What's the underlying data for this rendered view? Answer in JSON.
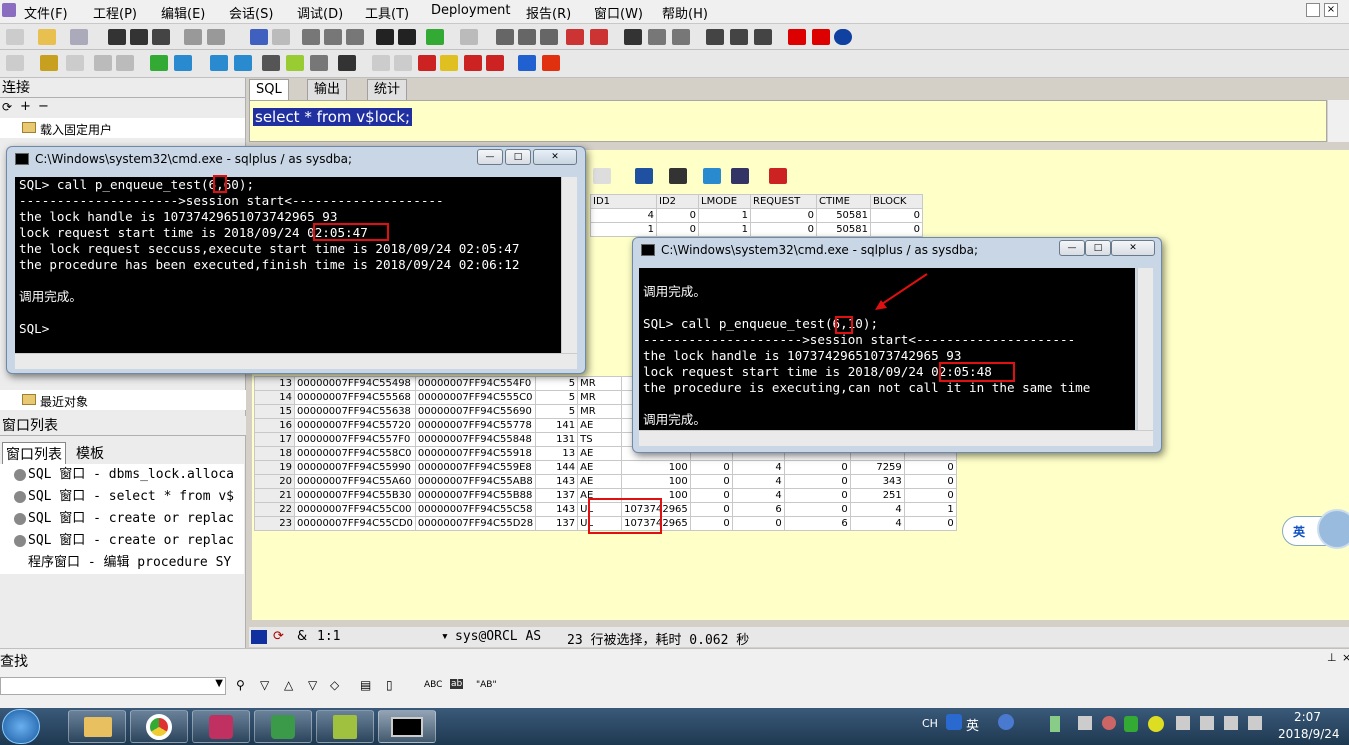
{
  "menu": [
    "文件(F)",
    "工程(P)",
    "编辑(E)",
    "会话(S)",
    "调试(D)",
    "工具(T)",
    "Deployment",
    "报告(R)",
    "窗口(W)",
    "帮助(H)"
  ],
  "left": {
    "connect_title": "连接",
    "tree_item": "载入固定用户",
    "recent_item": "最近对象",
    "winlist_title": "窗口列表",
    "tabs": [
      "窗口列表",
      "模板"
    ],
    "windows": [
      "SQL 窗口 - dbms_lock.alloca",
      "SQL 窗口 - select * from v$",
      "SQL 窗口 - create or replac",
      "SQL 窗口 - create or replac",
      "程序窗口 - 编辑 procedure SY"
    ]
  },
  "sql_tabs": [
    "SQL",
    "输出",
    "统计"
  ],
  "editor_text": "select * from v$lock;",
  "grid": {
    "headers": [
      "ID1",
      "ID2",
      "LMODE",
      "REQUEST",
      "CTIME",
      "BLOCK"
    ],
    "top_rows": [
      [
        "4",
        "0",
        "1",
        "0",
        "50581",
        "0"
      ],
      [
        "1",
        "0",
        "1",
        "0",
        "50581",
        "0"
      ]
    ],
    "rows": [
      [
        "13",
        "00000007FF94C55498",
        "00000007FF94C554F0",
        "5",
        "MR",
        "",
        "",
        "",
        "",
        "",
        ""
      ],
      [
        "14",
        "00000007FF94C55568",
        "00000007FF94C555C0",
        "5",
        "MR",
        "",
        "",
        "",
        "",
        "",
        ""
      ],
      [
        "15",
        "00000007FF94C55638",
        "00000007FF94C55690",
        "5",
        "MR",
        "",
        "",
        "",
        "",
        "",
        ""
      ],
      [
        "16",
        "00000007FF94C55720",
        "00000007FF94C55778",
        "141",
        "AE",
        "",
        "",
        "",
        "",
        "",
        ""
      ],
      [
        "17",
        "00000007FF94C557F0",
        "00000007FF94C55848",
        "131",
        "TS",
        "",
        "",
        "",
        "",
        "",
        ""
      ],
      [
        "18",
        "00000007FF94C558C0",
        "00000007FF94C55918",
        "13",
        "AE",
        "",
        "",
        "",
        "",
        "",
        ""
      ],
      [
        "19",
        "00000007FF94C55990",
        "00000007FF94C559E8",
        "144",
        "AE",
        "100",
        "0",
        "4",
        "0",
        "7259",
        "0"
      ],
      [
        "20",
        "00000007FF94C55A60",
        "00000007FF94C55AB8",
        "143",
        "AE",
        "100",
        "0",
        "4",
        "0",
        "343",
        "0"
      ],
      [
        "21",
        "00000007FF94C55B30",
        "00000007FF94C55B88",
        "137",
        "AE",
        "100",
        "0",
        "4",
        "0",
        "251",
        "0"
      ],
      [
        "22",
        "00000007FF94C55C00",
        "00000007FF94C55C58",
        "143",
        "UL",
        "1073742965",
        "0",
        "6",
        "0",
        "4",
        "1"
      ],
      [
        "23",
        "00000007FF94C55CD0",
        "00000007FF94C55D28",
        "137",
        "UL",
        "1073742965",
        "0",
        "0",
        "6",
        "4",
        "0"
      ]
    ]
  },
  "cmd1": {
    "title": "C:\\Windows\\system32\\cmd.exe - sqlplus  / as sysdba;",
    "lines": [
      "SQL> call p_enqueue_test(6,60);",
      "--------------------->session start<--------------------",
      "the lock handle is 10737429651073742965 93",
      "lock request start time is 2018/09/24 02:05:47",
      "the lock request seccuss,execute start time is 2018/09/24 02:05:47",
      "the procedure has been executed,finish time is 2018/09/24 02:06:12",
      "",
      "调用完成。",
      "",
      "SQL>"
    ]
  },
  "cmd2": {
    "title": "C:\\Windows\\system32\\cmd.exe - sqlplus  / as sysdba;",
    "lines": [
      "",
      "调用完成。",
      "",
      "SQL> call p_enqueue_test(6,10);",
      "--------------------->session start<---------------------",
      "the lock handle is 10737429651073742965 93",
      "lock request start time is 2018/09/24 02:05:48",
      "the procedure is executing,can not call it in the same time",
      "",
      "调用完成。"
    ]
  },
  "status": {
    "pos": "1:1",
    "conn": "sys@ORCL AS",
    "msg": "23 行被选择，耗时 0.062 秒"
  },
  "find_title": "查找",
  "find_opts": [
    "ABC",
    "\"AB\""
  ],
  "ime": "英",
  "tray": {
    "lang": "CH",
    "ime": "英",
    "time": "2:07",
    "date": "2018/9/24"
  }
}
